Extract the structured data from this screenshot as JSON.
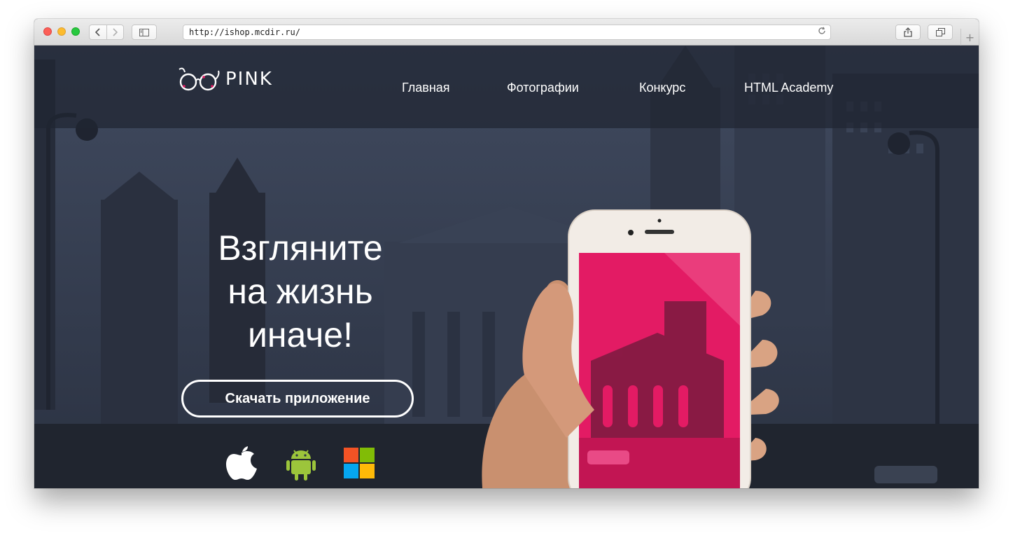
{
  "browser": {
    "url": "http://ishop.mcdir.ru/",
    "back_icon": "chevron-left-icon",
    "forward_icon": "chevron-right-icon",
    "sidebar_icon": "sidebar-icon",
    "share_icon": "share-icon",
    "tabs_icon": "tabs-icon",
    "reload_icon": "reload-icon",
    "new_tab": "+"
  },
  "header": {
    "logo_text": "PINK",
    "nav": [
      "Главная",
      "Фотографии",
      "Конкурс",
      "HTML Academy"
    ]
  },
  "hero": {
    "title_lines": [
      "Взгляните",
      "на жизнь",
      "иначе!"
    ],
    "download_button": "Скачать приложение",
    "stores": [
      "apple-icon",
      "android-icon",
      "windows-icon"
    ]
  },
  "colors": {
    "accent": "#e31b64",
    "overlay": "#2d3545"
  }
}
